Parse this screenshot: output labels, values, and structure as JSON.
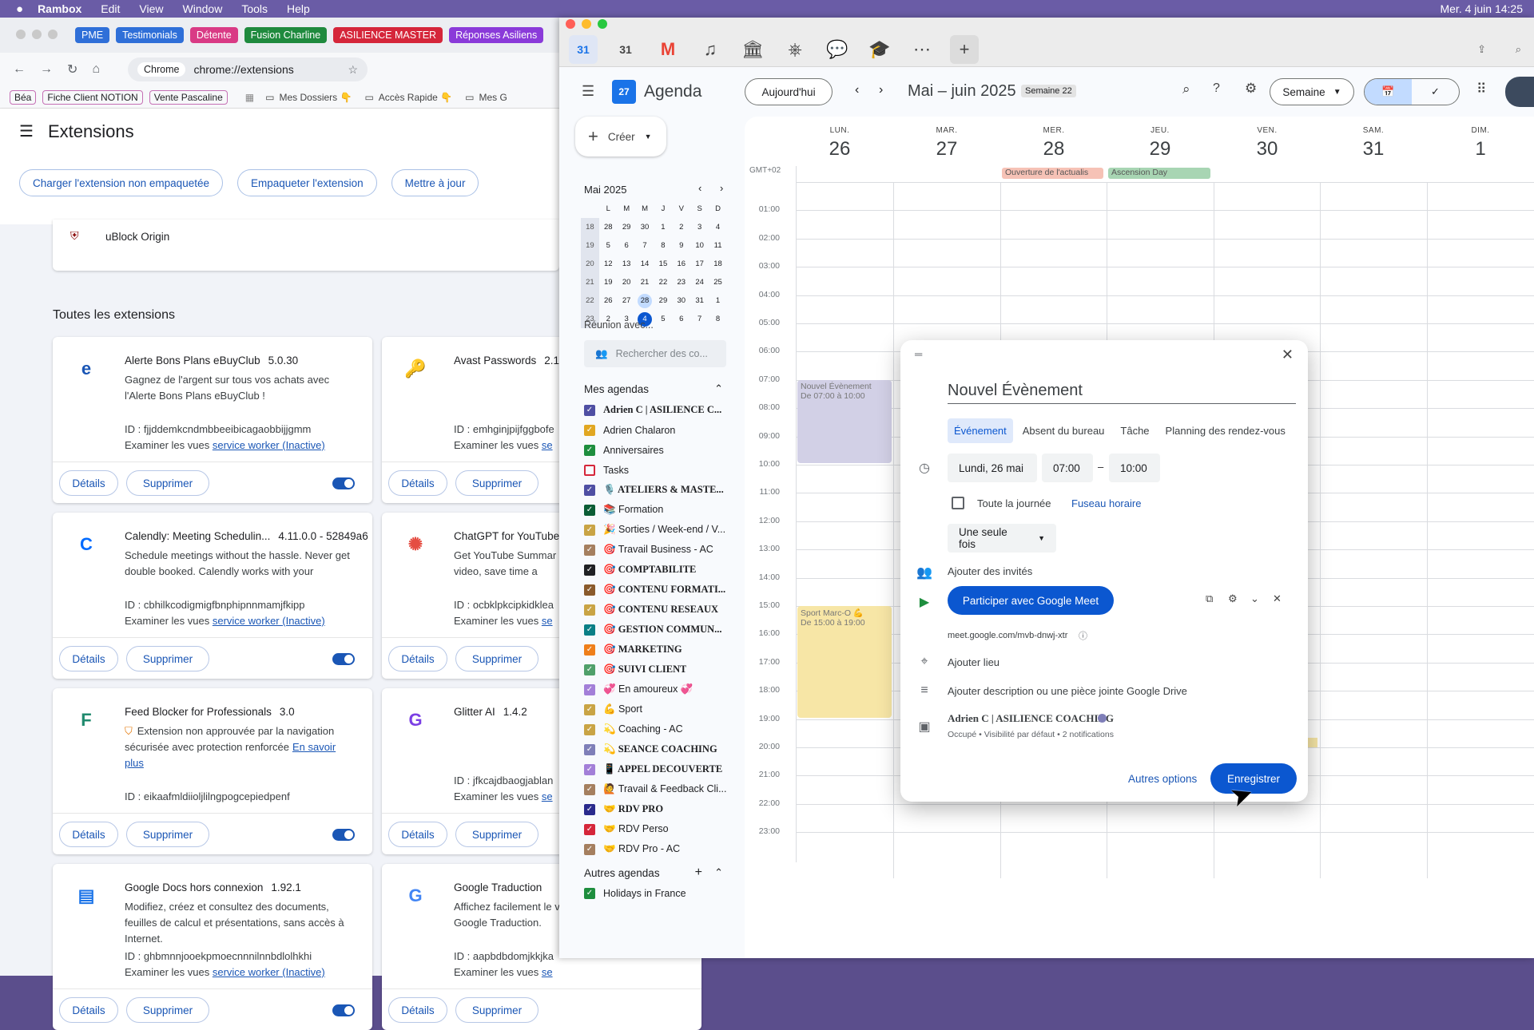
{
  "menubar": {
    "apple": "",
    "app": "Rambox",
    "items": [
      "Edit",
      "View",
      "Window",
      "Tools",
      "Help"
    ],
    "status": "Mer. 4 juin  14:25"
  },
  "chrome_tabs": [
    {
      "label": "PME",
      "color": "#2f6fd8"
    },
    {
      "label": "Testimonials",
      "color": "#2f6fd8"
    },
    {
      "label": "Détente",
      "color": "#d93a85"
    },
    {
      "label": "Fusion Charline",
      "color": "#1f8a3e"
    },
    {
      "label": "ASILIENCE MASTER",
      "color": "#d5263a"
    },
    {
      "label": "Réponses Asiliens",
      "color": "#8a3ad9"
    }
  ],
  "url": "chrome://extensions",
  "url_chip": "Chrome",
  "bookmarks": {
    "chips": [
      "Béa",
      "Fiche Client NOTION",
      "Vente Pascaline"
    ],
    "folders": [
      "Mes Dossiers 👇",
      "Accès Rapide 👇",
      "Mes G"
    ]
  },
  "extensions": {
    "title": "Extensions",
    "buttons": [
      "Charger l'extension non empaquetée",
      "Empaqueter l'extension",
      "Mettre à jour"
    ],
    "pinned": "uBlock Origin",
    "section": "Toutes les extensions",
    "details": "Détails",
    "remove": "Supprimer",
    "cards": [
      {
        "name": "Alerte Bons Plans eBuyClub",
        "version": "5.0.30",
        "desc": "Gagnez de l'argent sur tous vos achats avec l'Alerte Bons Plans eBuyClub !",
        "id": "ID : fjjddemkcndmbbeeibicagaobbijjgmm",
        "sw": "Examiner les vues",
        "link": "service worker (Inactive)",
        "icon": "e",
        "icolor": "#1a56b5"
      },
      {
        "name": "Avast Passwords",
        "version": "2.1.",
        "desc": "",
        "id": "ID : emhginjpijfggbofe",
        "sw": "Examiner les vues",
        "link": "se",
        "icon": "🔑",
        "icolor": "#ff7b00"
      },
      {
        "name": "Calendly: Meeting Schedulin...",
        "version": "4.11.0.0 - 52849a6",
        "desc": "Schedule meetings without the hassle. Never get double booked. Calendly works with your",
        "id": "ID : cbhilkcodigmigfbnphipnnmamjfkipp",
        "sw": "Examiner les vues",
        "link": "service worker (Inactive)",
        "icon": "C",
        "icolor": "#006bff"
      },
      {
        "name": "ChatGPT for YouTube",
        "version": "",
        "desc": "Get YouTube Summar seconds and let you c the video, save time a",
        "id": "ID : ocbklpkcipkidklea",
        "sw": "Examiner les vues",
        "link": "se",
        "icon": "✺",
        "icolor": "#e54d42"
      },
      {
        "name": "Feed Blocker for Professionals",
        "version": "3.0",
        "desc": "Extension non approuvée par la navigation sécurisée avec protection renforcée",
        "warnlink": "En savoir plus",
        "id": "ID : eikaafmldiioljlilngpogcepiedpenf",
        "sw": "",
        "link": "",
        "icon": "F",
        "icolor": "#1f8a6e"
      },
      {
        "name": "Glitter AI",
        "version": "1.4.2",
        "desc": "",
        "id": "ID : jfkcajdbaogjablan",
        "sw": "Examiner les vues",
        "link": "se",
        "icon": "G",
        "icolor": "#7b3fe4"
      },
      {
        "name": "Google Docs hors connexion",
        "version": "1.92.1",
        "desc": "Modifiez, créez et consultez des documents, feuilles de calcul et présentations, sans accès à Internet.",
        "id": "ID : ghbmnnjooekpmoecnnnilnnbdlolhkhi",
        "sw": "Examiner les vues",
        "link": "service worker (Inactive)",
        "icon": "▤",
        "icolor": "#1a73e8"
      },
      {
        "name": "Google Traduction",
        "version": "",
        "desc": "Affichez facilement le vous naviguez sur le W Google Traduction.",
        "id": "ID : aapbdbdomjkkjka",
        "sw": "Examiner les vues",
        "link": "se",
        "icon": "G",
        "icolor": "#4285f4"
      }
    ]
  },
  "gcal": {
    "title": "Agenda",
    "today": "Aujourd'hui",
    "range": "Mai – juin 2025",
    "week_badge": "Semaine 22",
    "view": "Semaine",
    "create": "Créer",
    "gmt": "GMT+02",
    "days": [
      {
        "n": "LUN.",
        "d": "26"
      },
      {
        "n": "MAR.",
        "d": "27"
      },
      {
        "n": "MER.",
        "d": "28"
      },
      {
        "n": "JEU.",
        "d": "29"
      },
      {
        "n": "VEN.",
        "d": "30"
      },
      {
        "n": "SAM.",
        "d": "31"
      },
      {
        "n": "DIM.",
        "d": "1"
      }
    ],
    "allday": [
      {
        "label": "Ouverture de l'actualis",
        "color": "#f6c2b6",
        "col": 2
      },
      {
        "label": "Ascension Day",
        "color": "#a8d5b3",
        "col": 3
      }
    ],
    "hours": [
      "01:00",
      "02:00",
      "03:00",
      "04:00",
      "05:00",
      "06:00",
      "07:00",
      "08:00",
      "09:00",
      "10:00",
      "11:00",
      "12:00",
      "13:00",
      "14:00",
      "15:00",
      "16:00",
      "17:00",
      "18:00",
      "19:00",
      "20:00",
      "21:00",
      "22:00",
      "23:00"
    ],
    "events": [
      {
        "title": "Nouvel Évènement",
        "time": "De 07:00 à 10:00",
        "color": "#d2d0e6",
        "start": 7,
        "end": 10
      },
      {
        "title": "Sport Marc-O 💪",
        "time": "De 15:00 à 19:00",
        "color": "#f7e6a6",
        "start": 15,
        "end": 19
      }
    ],
    "mini": {
      "month": "Mai 2025",
      "dow": [
        "L",
        "M",
        "M",
        "J",
        "V",
        "S",
        "D"
      ],
      "weeks": [
        [
          "18",
          "28",
          "29",
          "30",
          "1",
          "2",
          "3",
          "4"
        ],
        [
          "19",
          "5",
          "6",
          "7",
          "8",
          "9",
          "10",
          "11"
        ],
        [
          "20",
          "12",
          "13",
          "14",
          "15",
          "16",
          "17",
          "18"
        ],
        [
          "21",
          "19",
          "20",
          "21",
          "22",
          "23",
          "24",
          "25"
        ],
        [
          "22",
          "26",
          "27",
          "28",
          "29",
          "30",
          "31",
          "1"
        ],
        [
          "23",
          "2",
          "3",
          "4",
          "5",
          "6",
          "7",
          "8"
        ]
      ]
    },
    "meet_with": "Réunion avec...",
    "search_people": "Rechercher des co...",
    "my_cals_title": "Mes agendas",
    "my_cals": [
      {
        "l": "Adrien C | ASILIENCE C...",
        "c": "#4f4fa3",
        "on": true,
        "b": true
      },
      {
        "l": "Adrien Chalaron",
        "c": "#e1a722",
        "on": true
      },
      {
        "l": "Anniversaires",
        "c": "#1e8e3e",
        "on": true
      },
      {
        "l": "Tasks",
        "c": "#d5263a",
        "on": false
      },
      {
        "l": "🎙️ ATELIERS & MASTE...",
        "c": "#4f4fa3",
        "on": true,
        "b": true
      },
      {
        "l": "📚 Formation",
        "c": "#0b5d35",
        "on": true
      },
      {
        "l": "🎉 Sorties / Week-end / V...",
        "c": "#c9a445",
        "on": true
      },
      {
        "l": "🎯 Travail Business - AC",
        "c": "#a57f5f",
        "on": true
      },
      {
        "l": "🎯 COMPTABILITE",
        "c": "#202124",
        "on": true,
        "b": true
      },
      {
        "l": "🎯 CONTENU FORMATI...",
        "c": "#8a5a2b",
        "on": true,
        "b": true
      },
      {
        "l": "🎯 CONTENU RESEAUX",
        "c": "#c9a445",
        "on": true,
        "b": true
      },
      {
        "l": "🎯 GESTION COMMUN...",
        "c": "#0b7f86",
        "on": true,
        "b": true
      },
      {
        "l": "🎯 MARKETING",
        "c": "#ef7f1a",
        "on": true,
        "b": true
      },
      {
        "l": "🎯 SUIVI CLIENT",
        "c": "#50a06a",
        "on": true,
        "b": true
      },
      {
        "l": "💞 En amoureux 💞",
        "c": "#a37fd8",
        "on": true
      },
      {
        "l": "💪 Sport",
        "c": "#c9a445",
        "on": true
      },
      {
        "l": "💫 Coaching - AC",
        "c": "#c9a445",
        "on": true
      },
      {
        "l": "💫 SEANCE COACHING",
        "c": "#7f7fb8",
        "on": true,
        "b": true
      },
      {
        "l": "📱 APPEL DECOUVERTE",
        "c": "#a37fd8",
        "on": true,
        "b": true
      },
      {
        "l": "🙋 Travail & Feedback Cli...",
        "c": "#a57f5f",
        "on": true
      },
      {
        "l": "🤝 RDV PRO",
        "c": "#2a2a8c",
        "on": true,
        "b": true
      },
      {
        "l": "🤝 RDV Perso",
        "c": "#d5263a",
        "on": true
      },
      {
        "l": "🤝 RDV Pro - AC",
        "c": "#a57f5f",
        "on": true
      }
    ],
    "other_cals_title": "Autres agendas",
    "other_cals": [
      {
        "l": "Holidays in France",
        "c": "#1e8e3e",
        "on": true
      }
    ]
  },
  "modal": {
    "title": "Nouvel Évènement",
    "tabs": [
      "Événement",
      "Absent du bureau",
      "Tâche",
      "Planning des rendez-vous"
    ],
    "date": "Lundi, 26 mai",
    "start": "07:00",
    "dash": "–",
    "end": "10:00",
    "allday": "Toute la journée",
    "timezone": "Fuseau horaire",
    "repeat": "Une seule fois",
    "guests": "Ajouter des invités",
    "meet_btn": "Participer avec Google Meet",
    "meet_link": "meet.google.com/mvb-dnwj-xtr",
    "location": "Ajouter lieu",
    "desc": "Ajouter description ou une pièce jointe Google Drive",
    "cal_name": "Adrien C | ASILIENCE COACHING",
    "cal_sub": "Occupé • Visibilité par défaut • 2 notifications",
    "more": "Autres options",
    "save": "Enregistrer"
  }
}
